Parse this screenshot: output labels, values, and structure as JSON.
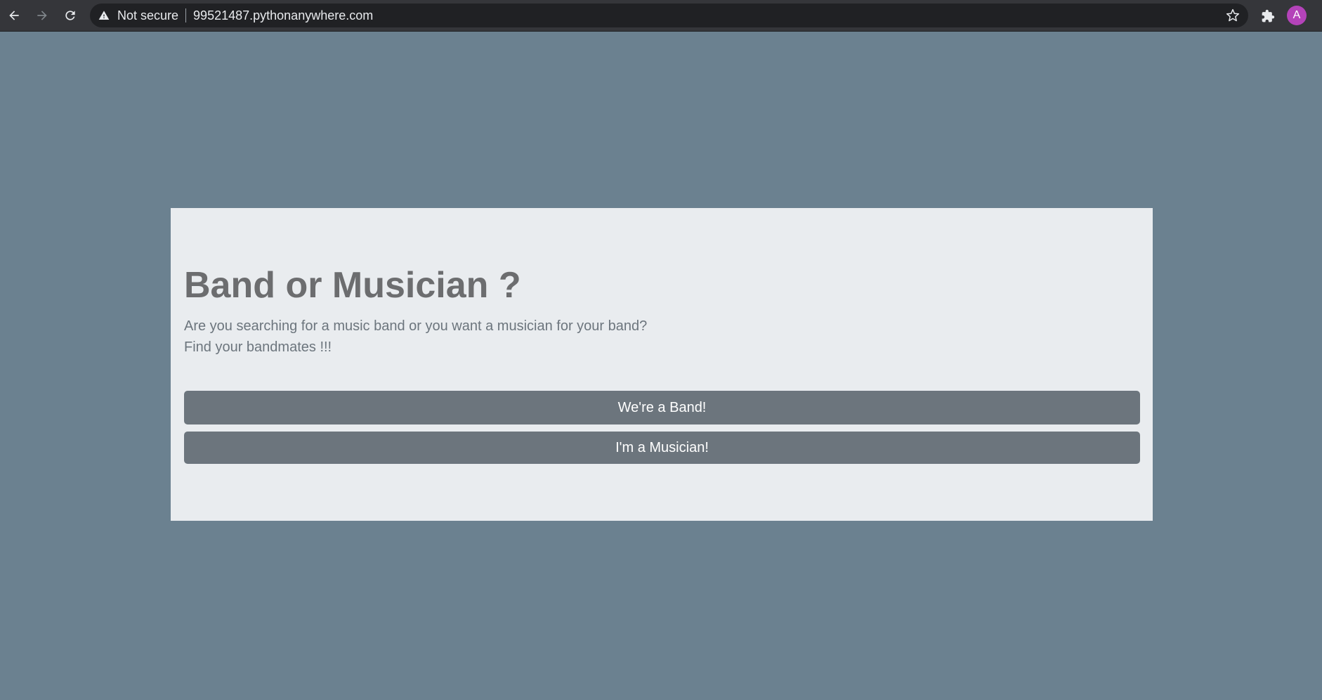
{
  "browser": {
    "security_label": "Not secure",
    "url": "99521487.pythonanywhere.com",
    "profile_initial": "A",
    "profile_color": "#b443b9",
    "icons": [
      "back-arrow-icon",
      "forward-arrow-icon",
      "reload-icon",
      "warning-icon",
      "star-icon",
      "puzzle-icon"
    ]
  },
  "page": {
    "background_color": "#6b8190",
    "card_color": "#e9ecef",
    "title": "Band or Musician ?",
    "lead_line1": "Are you searching for a music band or you want a musician for your band?",
    "lead_line2": "Find your bandmates !!!",
    "buttons": {
      "band_label": "We're a Band!",
      "musician_label": "I'm a Musician!"
    },
    "button_color": "#6c757d"
  }
}
